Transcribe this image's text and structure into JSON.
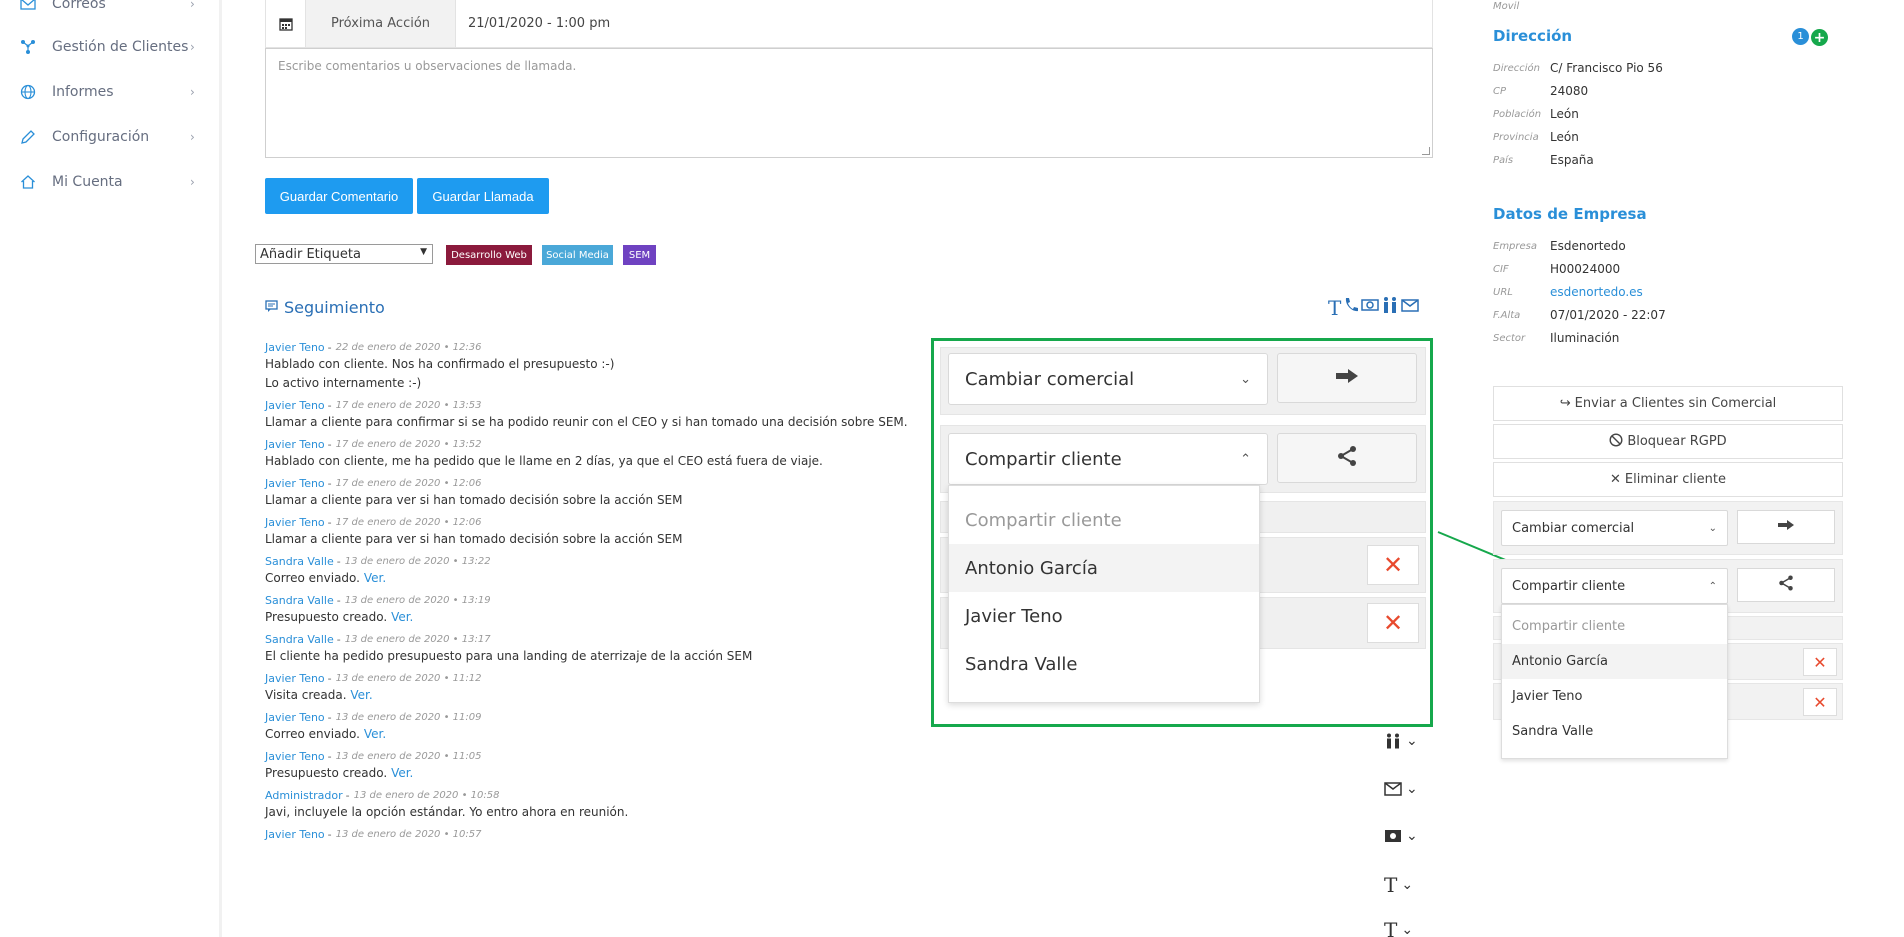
{
  "sidebar": {
    "items": [
      {
        "label": "Correos",
        "icon": "mail-icon"
      },
      {
        "label": "Gestión de Clientes",
        "icon": "network-icon"
      },
      {
        "label": "Informes",
        "icon": "globe-icon"
      },
      {
        "label": "Configuración",
        "icon": "pencil-icon"
      },
      {
        "label": "Mi Cuenta",
        "icon": "home-icon"
      }
    ]
  },
  "action": {
    "label": "Próxima Acción",
    "value": "21/01/2020 - 1:00 pm"
  },
  "comment": {
    "placeholder": "Escribe comentarios u observaciones de llamada."
  },
  "buttons": {
    "save_comment": "Guardar Comentario",
    "save_call": "Guardar Llamada"
  },
  "tags": {
    "select_label": "Añadir Etiqueta",
    "items": [
      {
        "label": "Desarrollo Web",
        "color": "#8b1a3c"
      },
      {
        "label": "Social Media",
        "color": "#4aa8d8"
      },
      {
        "label": "SEM",
        "color": "#6f42c1"
      }
    ]
  },
  "seguimiento": {
    "title": "Seguimiento"
  },
  "entries": [
    {
      "author": "Javier Teno",
      "date": "22 de enero de 2020 • 12:36",
      "lines": [
        "Hablado con cliente. Nos ha confirmado el presupuesto :-)",
        "Lo activo internamente :-)"
      ],
      "link": ""
    },
    {
      "author": "Javier Teno",
      "date": "17 de enero de 2020 • 13:53",
      "lines": [
        "Llamar a cliente para confirmar si se ha podido reunir con el CEO y si han tomado una decisión sobre SEM."
      ],
      "link": ""
    },
    {
      "author": "Javier Teno",
      "date": "17 de enero de 2020 • 13:52",
      "lines": [
        "Hablado con cliente, me ha pedido que le llame en 2 días, ya que el CEO está fuera de viaje."
      ],
      "link": ""
    },
    {
      "author": "Javier Teno",
      "date": "17 de enero de 2020 • 12:06",
      "lines": [
        "Llamar a cliente para ver si han tomado decisión sobre la acción SEM"
      ],
      "link": ""
    },
    {
      "author": "Javier Teno",
      "date": "17 de enero de 2020 • 12:06",
      "lines": [
        "Llamar a cliente para ver si han tomado decisión sobre la acción SEM"
      ],
      "link": ""
    },
    {
      "author": "Sandra Valle",
      "date": "13 de enero de 2020 • 13:22",
      "lines": [
        "Correo enviado."
      ],
      "link": "Ver."
    },
    {
      "author": "Sandra Valle",
      "date": "13 de enero de 2020 • 13:19",
      "lines": [
        "Presupuesto creado."
      ],
      "link": "Ver."
    },
    {
      "author": "Sandra Valle",
      "date": "13 de enero de 2020 • 13:17",
      "lines": [
        "El cliente ha pedido presupuesto para una landing de aterrizaje de la acción SEM"
      ],
      "link": ""
    },
    {
      "author": "Javier Teno",
      "date": "13 de enero de 2020 • 11:12",
      "lines": [
        "Visita creada."
      ],
      "link": "Ver."
    },
    {
      "author": "Javier Teno",
      "date": "13 de enero de 2020 • 11:09",
      "lines": [
        "Correo enviado."
      ],
      "link": "Ver."
    },
    {
      "author": "Javier Teno",
      "date": "13 de enero de 2020 • 11:05",
      "lines": [
        "Presupuesto creado."
      ],
      "link": "Ver."
    },
    {
      "author": "Administrador",
      "date": "13 de enero de 2020 • 10:58",
      "lines": [
        "Javi, incluyele la opción estándar. Yo entro ahora en reunión."
      ],
      "link": ""
    },
    {
      "author": "Javier Teno",
      "date": "13 de enero de 2020 • 10:57",
      "lines": [],
      "link": ""
    }
  ],
  "zoom": {
    "cambiar_comercial": "Cambiar comercial",
    "compartir_cliente": "Compartir cliente",
    "options": [
      "Compartir cliente",
      "Antonio García",
      "Javier Teno",
      "Sandra Valle"
    ]
  },
  "right": {
    "movil_label": "Movil",
    "direccion_title": "Dirección",
    "direccion_count": "1",
    "direccion": [
      {
        "k": "Dirección",
        "v": "C/ Francisco Pio 56"
      },
      {
        "k": "CP",
        "v": "24080"
      },
      {
        "k": "Población",
        "v": "León"
      },
      {
        "k": "Provincia",
        "v": "León"
      },
      {
        "k": "País",
        "v": "España"
      }
    ],
    "empresa_title": "Datos de Empresa",
    "empresa": [
      {
        "k": "Empresa",
        "v": "Esdenortedo"
      },
      {
        "k": "CIF",
        "v": "H00024000"
      },
      {
        "k": "URL",
        "v": "esdenortedo.es"
      },
      {
        "k": "F.Alta",
        "v": "07/01/2020 - 22:07"
      },
      {
        "k": "Sector",
        "v": "Iluminación"
      }
    ],
    "actions": [
      "Enviar a Clientes sin Comercial",
      "Bloquear RGPD",
      "Eliminar cliente"
    ],
    "cambiar_comercial": "Cambiar comercial",
    "compartir_cliente": "Compartir cliente",
    "options": [
      "Compartir cliente",
      "Antonio García",
      "Javier Teno",
      "Sandra Valle"
    ]
  },
  "colors": {
    "accent": "#1e9bf0",
    "link": "#2a8fd8",
    "highlight": "#16a84c",
    "danger": "#e84a2e"
  }
}
